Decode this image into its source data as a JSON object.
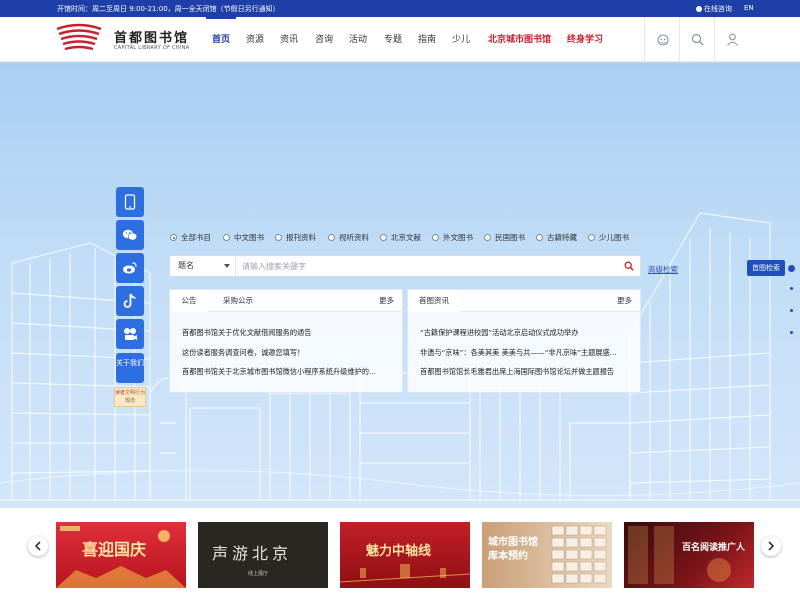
{
  "topbar": {
    "hours": "开馆时间：周二至周日 9:00-21:00，周一全天闭馆（节假日另行通知）",
    "consult": "在线咨询",
    "lang": "EN"
  },
  "logo": {
    "cn": "首都图书馆",
    "en": "CAPITAL LIBRARY OF CHINA"
  },
  "nav": [
    {
      "label": "首页",
      "active": true
    },
    {
      "label": "资源"
    },
    {
      "label": "资讯"
    },
    {
      "label": "咨询"
    },
    {
      "label": "活动"
    },
    {
      "label": "专题"
    },
    {
      "label": "指南"
    },
    {
      "label": "少儿"
    },
    {
      "label": "北京城市图书馆",
      "highlight": true
    },
    {
      "label": "终身学习",
      "highlight": true
    }
  ],
  "header_icons": [
    "robot-icon",
    "search-icon",
    "user-icon"
  ],
  "social": {
    "buttons": [
      "mobile-icon",
      "wechat-icon",
      "weibo-icon",
      "tiktok-icon",
      "video-icon"
    ],
    "about": "关于我们",
    "notice": "读者文明行为规范"
  },
  "search": {
    "scopes": [
      "全部书目",
      "中文图书",
      "报刊资料",
      "视听资料",
      "北京文献",
      "外文图书",
      "民国图书",
      "古籍特藏",
      "少儿图书"
    ],
    "selected_scope": "全部书目",
    "field": "题名",
    "placeholder": "请输入搜索关键字",
    "advanced": "高级检索",
    "home_search": "首图检索"
  },
  "panel_left": {
    "tabs": [
      "公告",
      "采购公示"
    ],
    "more": "更多",
    "items": [
      "首都图书馆关于优化文献借阅服务的通告",
      "这份读者服务调查问卷，诚邀您填写！",
      "首都图书馆关于北京城市图书馆微信小程序系统升级维护的…"
    ]
  },
  "panel_right": {
    "tabs": [
      "首图资讯"
    ],
    "more": "更多",
    "items": [
      "“古籍保护课程进校园”活动北京启动仪式成功举办",
      "非遗与“京味”：各美其美 美美与共——“非凡京味”主题展盛…",
      "首都图书馆馆长毛雅君出席上海国际图书馆论坛并做主题报告"
    ]
  },
  "carousel": {
    "cards": [
      {
        "title": "喜迎国庆",
        "bg": "#c8202f"
      },
      {
        "title": "声游北京",
        "sub": "线上展厅",
        "bg": "#2a2622"
      },
      {
        "title": "魅力中轴线",
        "bg": "#b61820"
      },
      {
        "title": "城市图书馆 库本预约",
        "bg": "#d9b99a"
      },
      {
        "title": "百名阅读推广人",
        "bg": "#5a1014"
      }
    ]
  },
  "colors": {
    "brand_blue": "#1f3fa8",
    "highlight_red": "#c8202f"
  }
}
